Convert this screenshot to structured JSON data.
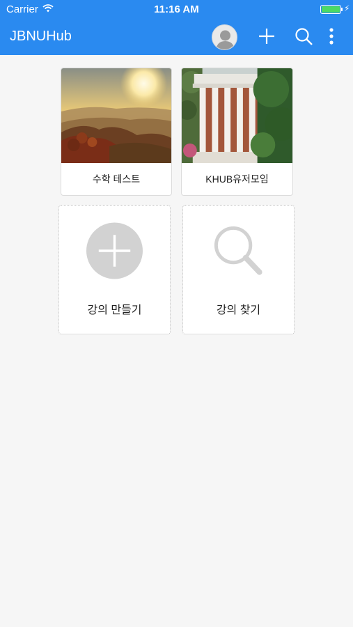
{
  "status_bar": {
    "carrier": "Carrier",
    "time": "11:16 AM",
    "battery_level": 1.0
  },
  "nav": {
    "title": "JBNUHub",
    "actions": [
      "avatar",
      "add-icon",
      "search-icon",
      "more-vertical-icon"
    ]
  },
  "courses": [
    {
      "label": "수학 테스트",
      "image": "sunrise-landscape"
    },
    {
      "label": "KHUB유저모임",
      "image": "columned-building"
    }
  ],
  "actions": [
    {
      "label": "강의 만들기",
      "icon": "add-circle-icon"
    },
    {
      "label": "강의 찾기",
      "icon": "search-icon"
    }
  ],
  "colors": {
    "primary": "#2a8af0",
    "background": "#f6f6f6",
    "icon_gray": "#d2d2d2",
    "battery": "#4cd964"
  }
}
